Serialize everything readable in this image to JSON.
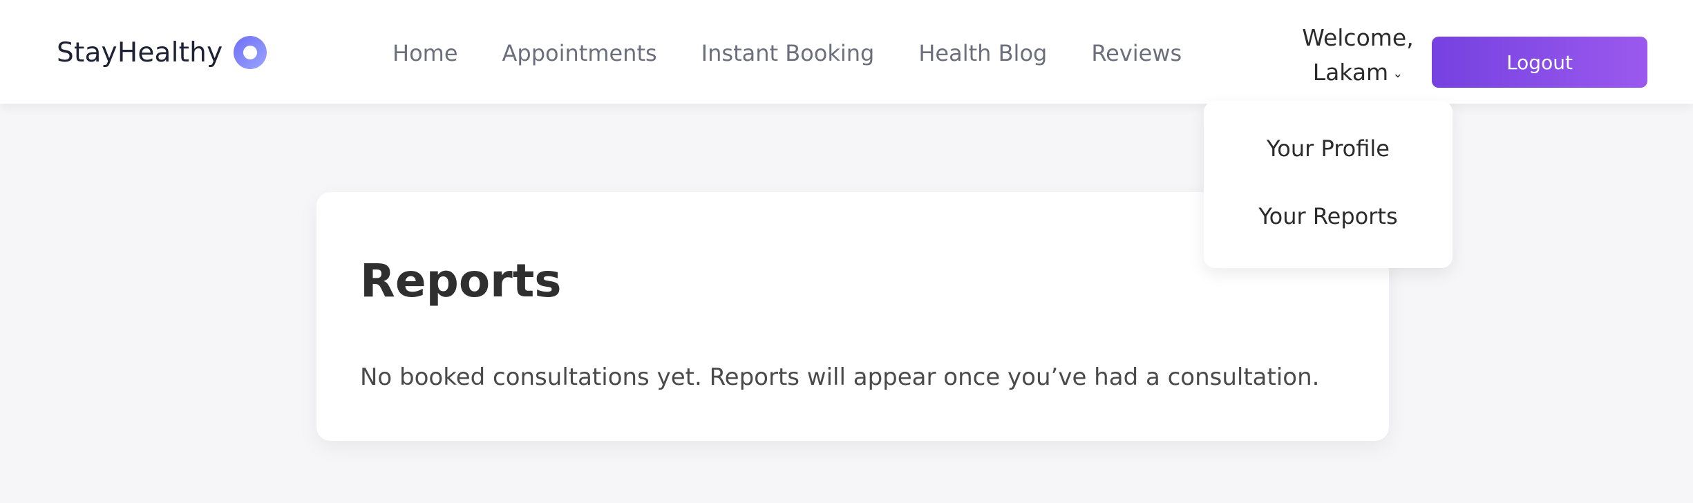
{
  "app": {
    "brand": "StayHealthy",
    "brand_logo_icon": "circle-logo-icon"
  },
  "nav": {
    "items": [
      "Home",
      "Appointments",
      "Instant Booking",
      "Health Blog",
      "Reviews"
    ]
  },
  "user": {
    "welcome_line1": "Welcome,",
    "welcome_line2": "Lakam",
    "dropdown_icon": "chevron-down-icon",
    "logout_label": "Logout",
    "menu": [
      "Your Profile",
      "Your Reports"
    ]
  },
  "reports": {
    "title": "Reports",
    "empty_message": "No booked consultations yet. Reports will appear once you’ve had a consultation."
  },
  "colors": {
    "accent_start": "#7541e0",
    "accent_end": "#9b59ee",
    "logo_start": "#6f6ff5",
    "logo_end": "#9aa4ff"
  }
}
